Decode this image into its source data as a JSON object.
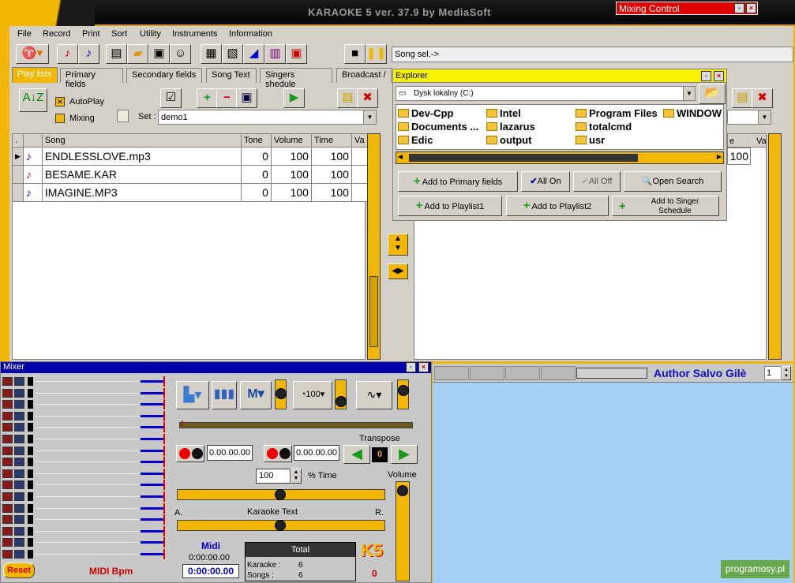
{
  "app": {
    "title": "KARAOKE 5   ver. 37.9 by MediaSoft"
  },
  "mixing_control": {
    "title": "Mixing Control"
  },
  "menu": [
    "File",
    "Record",
    "Print",
    "Sort",
    "Utility",
    "Instruments",
    "Information"
  ],
  "status": {
    "text": "Song sel.->"
  },
  "tabs": [
    "Play lists",
    "Primary fields",
    "Secondary fields",
    "Song Text",
    "Singers shedule",
    "Broadcast /"
  ],
  "playlist": {
    "autoplay_label": "AutoPlay",
    "mixing_label": "Mixing",
    "set_label": "Set :",
    "set_value": "demo1",
    "columns": [
      ".",
      "Song",
      "Tone",
      "Volume",
      "Time",
      "Va"
    ],
    "rows": [
      {
        "song": "ENDLESSLOVE.mp3",
        "tone": "0",
        "volume": "100",
        "time": "100"
      },
      {
        "song": "BESAME.KAR",
        "tone": "0",
        "volume": "100",
        "time": "100"
      },
      {
        "song": "IMAGINE.MP3",
        "tone": "0",
        "volume": "100",
        "time": "100"
      }
    ]
  },
  "right_list": {
    "cols": [
      "e",
      "Va"
    ],
    "value": "100"
  },
  "explorer": {
    "title": "Explorer",
    "drive": "Dysk lokalny (C:)",
    "folders": [
      "Dev-Cpp",
      "Intel",
      "Program Files",
      "WINDOW",
      "Documents ...",
      "lazarus",
      "totalcmd",
      "Edic",
      "output",
      "usr"
    ],
    "buttons": {
      "add_primary": "Add to Primary fields",
      "all_on": "All On",
      "all_off": "All Off",
      "open_search": "Open Search",
      "add_playlist1": "Add to Playlist1",
      "add_playlist2": "Add to Playlist2",
      "add_singer": "Add to Singer Schedule"
    }
  },
  "mixer": {
    "title": "Mixer",
    "time1": "0.00.00.00",
    "time2": "0.00.00.00",
    "transpose_label": "Transpose",
    "transpose_value": "0",
    "tempo_value": "100",
    "tempo_label": "% Time",
    "volume_label": "Volume",
    "karaoke_text_label": "Karaoke Text",
    "a_label": "A.",
    "r_label": "R.",
    "midi_label": "Midi",
    "midi_time1": "0:00:00.00",
    "midi_time2": "0:00:00.00",
    "total_label": "Total",
    "karaoke_count_label": "Karaoke :",
    "karaoke_count": "6",
    "songs_count_label": "Songs :",
    "songs_count": "6",
    "reset_label": "Reset",
    "midi_bpm_label": "MIDI Bpm",
    "k5_value": "0"
  },
  "author": {
    "text": "Author Salvo Gilè",
    "spin": "1"
  },
  "watermark": "programosy.pl"
}
